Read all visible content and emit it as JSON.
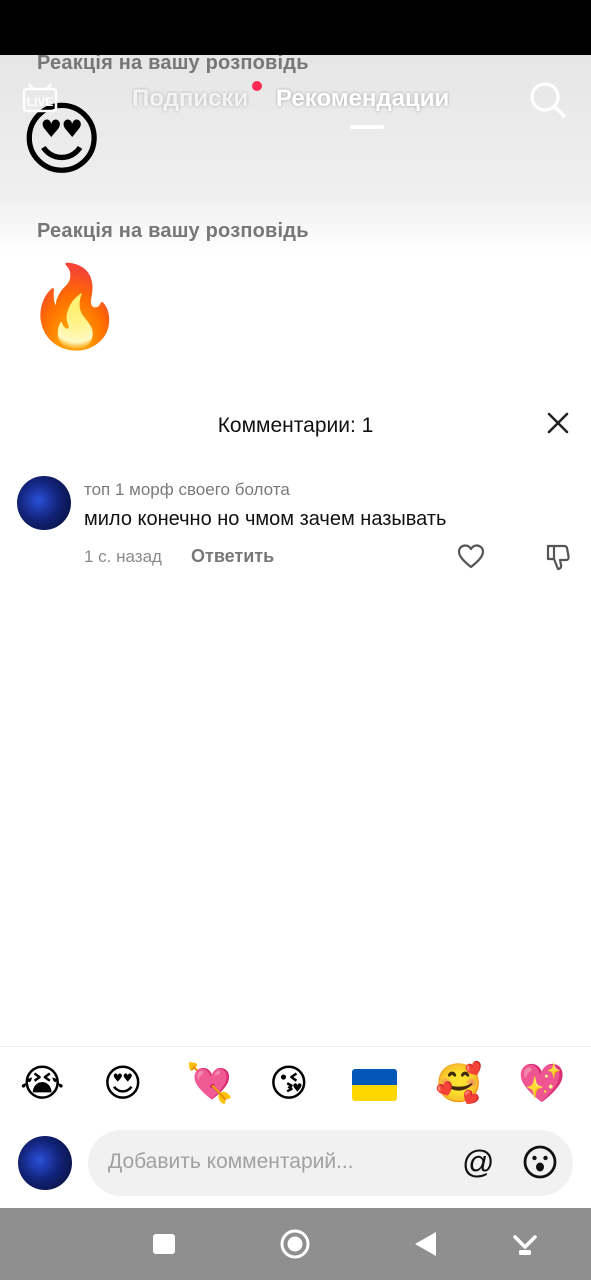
{
  "feed": {
    "labels": [
      "Реакція на вашу розповідь",
      "Реакція на вашу розповідь"
    ],
    "emojis": [
      "😍",
      "🔥"
    ]
  },
  "topnav": {
    "live_label": "LIVE",
    "tab_following": "Подписки",
    "tab_recommended": "Рекомендации"
  },
  "comments": {
    "title": "Комментарии: 1",
    "items": [
      {
        "username": "топ 1 морф своего болота",
        "text": "мило конечно но чмом зачем называть",
        "time": "1 с. назад",
        "reply_label": "Ответить"
      }
    ]
  },
  "quick_emojis": [
    "😭",
    "😍",
    "💘",
    "😘",
    "🇺🇦",
    "🥰",
    "💖"
  ],
  "input": {
    "placeholder": "Добавить комментарий...",
    "mention_symbol": "@"
  },
  "colors": {
    "accent": "#fe2c55",
    "flag_blue": "#0057b7",
    "flag_yellow": "#ffd700"
  },
  "icons": [
    "live-icon",
    "search-icon",
    "close-icon",
    "heart-icon",
    "dislike-icon",
    "emoji-icon",
    "square-icon",
    "circle-icon",
    "back-icon",
    "down-arrow-icon"
  ]
}
